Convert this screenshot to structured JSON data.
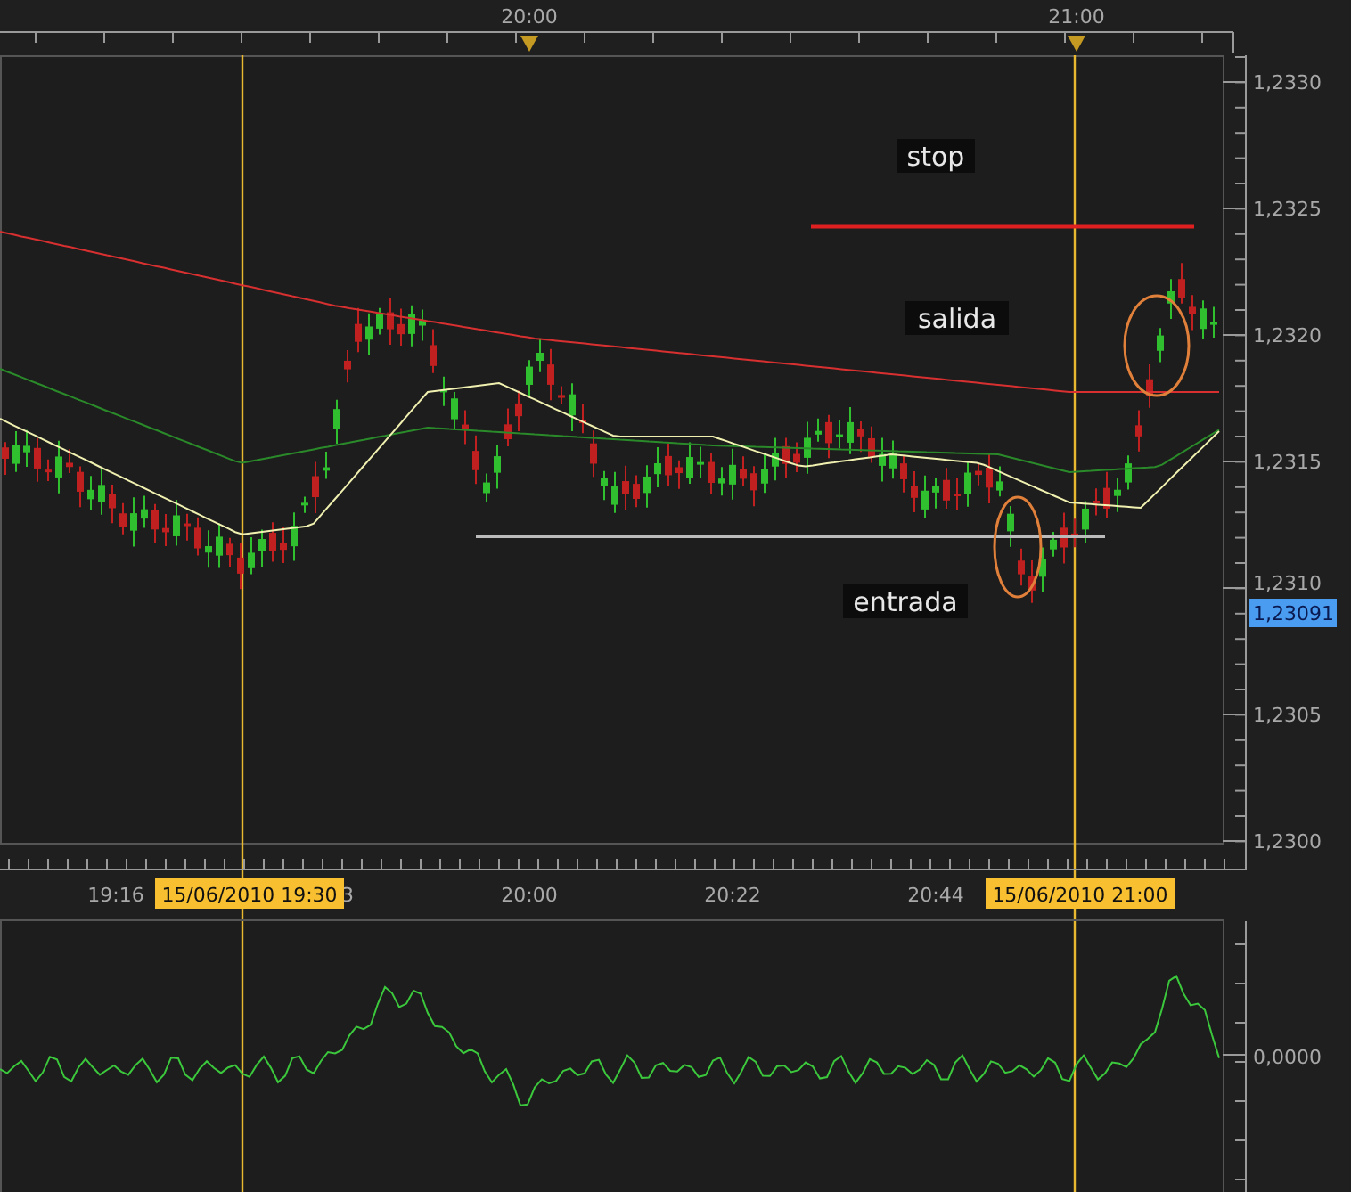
{
  "time_axis_top": {
    "labels": [
      "20:00",
      "21:00"
    ]
  },
  "price_axis": {
    "labels": [
      "1,2330",
      "1,2325",
      "1,2320",
      "1,2315",
      "1,2310",
      "1,2305",
      "1,2300"
    ],
    "current_price": "1,23091"
  },
  "annotations": [
    {
      "kind": "label",
      "text": "stop"
    },
    {
      "kind": "label",
      "text": "salida"
    },
    {
      "kind": "label",
      "text": "entrada"
    }
  ],
  "time_axis_bottom": {
    "labels": [
      "19:16",
      "3",
      "20:00",
      "20:22",
      "20:44"
    ],
    "markers": [
      "15/06/2010 19:30",
      "15/06/2010 21:00"
    ]
  },
  "indicator_axis": {
    "labels": [
      "0,0000"
    ]
  }
}
